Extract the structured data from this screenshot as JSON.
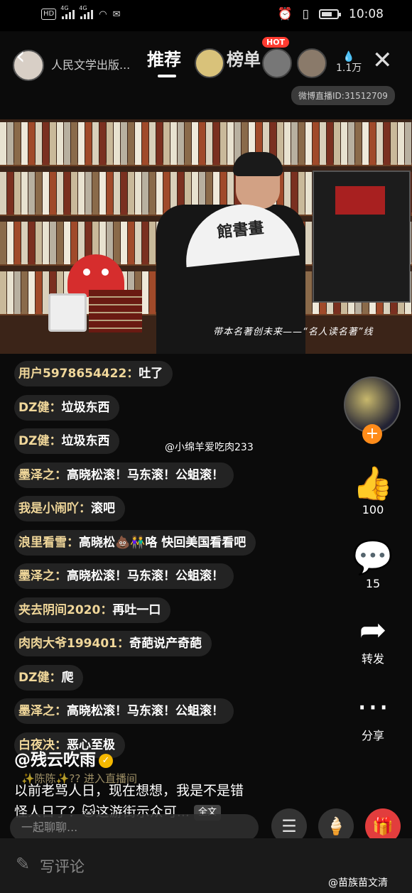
{
  "status_bar": {
    "hd": "HD",
    "net1": "4G",
    "net2": "4G",
    "time": "10:08"
  },
  "header": {
    "host_name": "人民文学出版...",
    "tab_recommend": "推荐",
    "tab_rank": "榜单",
    "hot_badge": "HOT",
    "viewer_count": "1.1万",
    "live_id": "微博直播ID:31512709"
  },
  "video": {
    "fan_text": "館書畫",
    "caption": "带本名著创未来——“名人读名著”线"
  },
  "chat": {
    "messages": [
      {
        "user": "用户5978654422：",
        "text": "吐了"
      },
      {
        "user": "DZ健：",
        "text": "垃圾东西"
      },
      {
        "user": "DZ健：",
        "text": "垃圾东西"
      },
      {
        "user": "墨泽之：",
        "text": "高晓松滚！马东滚！公蛆滚！"
      },
      {
        "user": "我是小闹吖：",
        "text": "滚吧"
      },
      {
        "user": "浪里看雪：",
        "text": "高晓松💩👫咯 快回美国看看吧"
      },
      {
        "user": "墨泽之：",
        "text": "高晓松滚！马东滚！公蛆滚！"
      },
      {
        "user": "夹去阴间2020：",
        "text": "再吐一口"
      },
      {
        "user": "肉肉大爷199401：",
        "text": "奇葩说产奇葩"
      },
      {
        "user": "DZ健：",
        "text": "爬"
      },
      {
        "user": "墨泽之：",
        "text": "高晓松滚！马东滚！公蛆滚！"
      },
      {
        "user": "白夜决：",
        "text": "恶心至极"
      }
    ],
    "enter_notice": "✨陈陈✨?? 进入直播间",
    "input_placeholder": "一起聊聊..."
  },
  "post": {
    "handle": "@残云吹雨",
    "line1": "以前老骂人日，现在想想，我是不是错",
    "line2": "怪人日了？🐱这游街示众可...",
    "full_text": "全文"
  },
  "watermarks": {
    "mid": "@小绵羊爱吃肉233",
    "bottom": "@苗族苗文清"
  },
  "actions": {
    "plus": "+",
    "like_count": "100",
    "comment_count": "15",
    "share_label": "转发",
    "more_label": "分享"
  },
  "bottom_bar": {
    "write_comment": "写评论"
  },
  "colors": {
    "username": "#f0d79a",
    "hot": "#ff3b30",
    "follow": "#ff8c1a",
    "gift": "#e23d3d"
  }
}
